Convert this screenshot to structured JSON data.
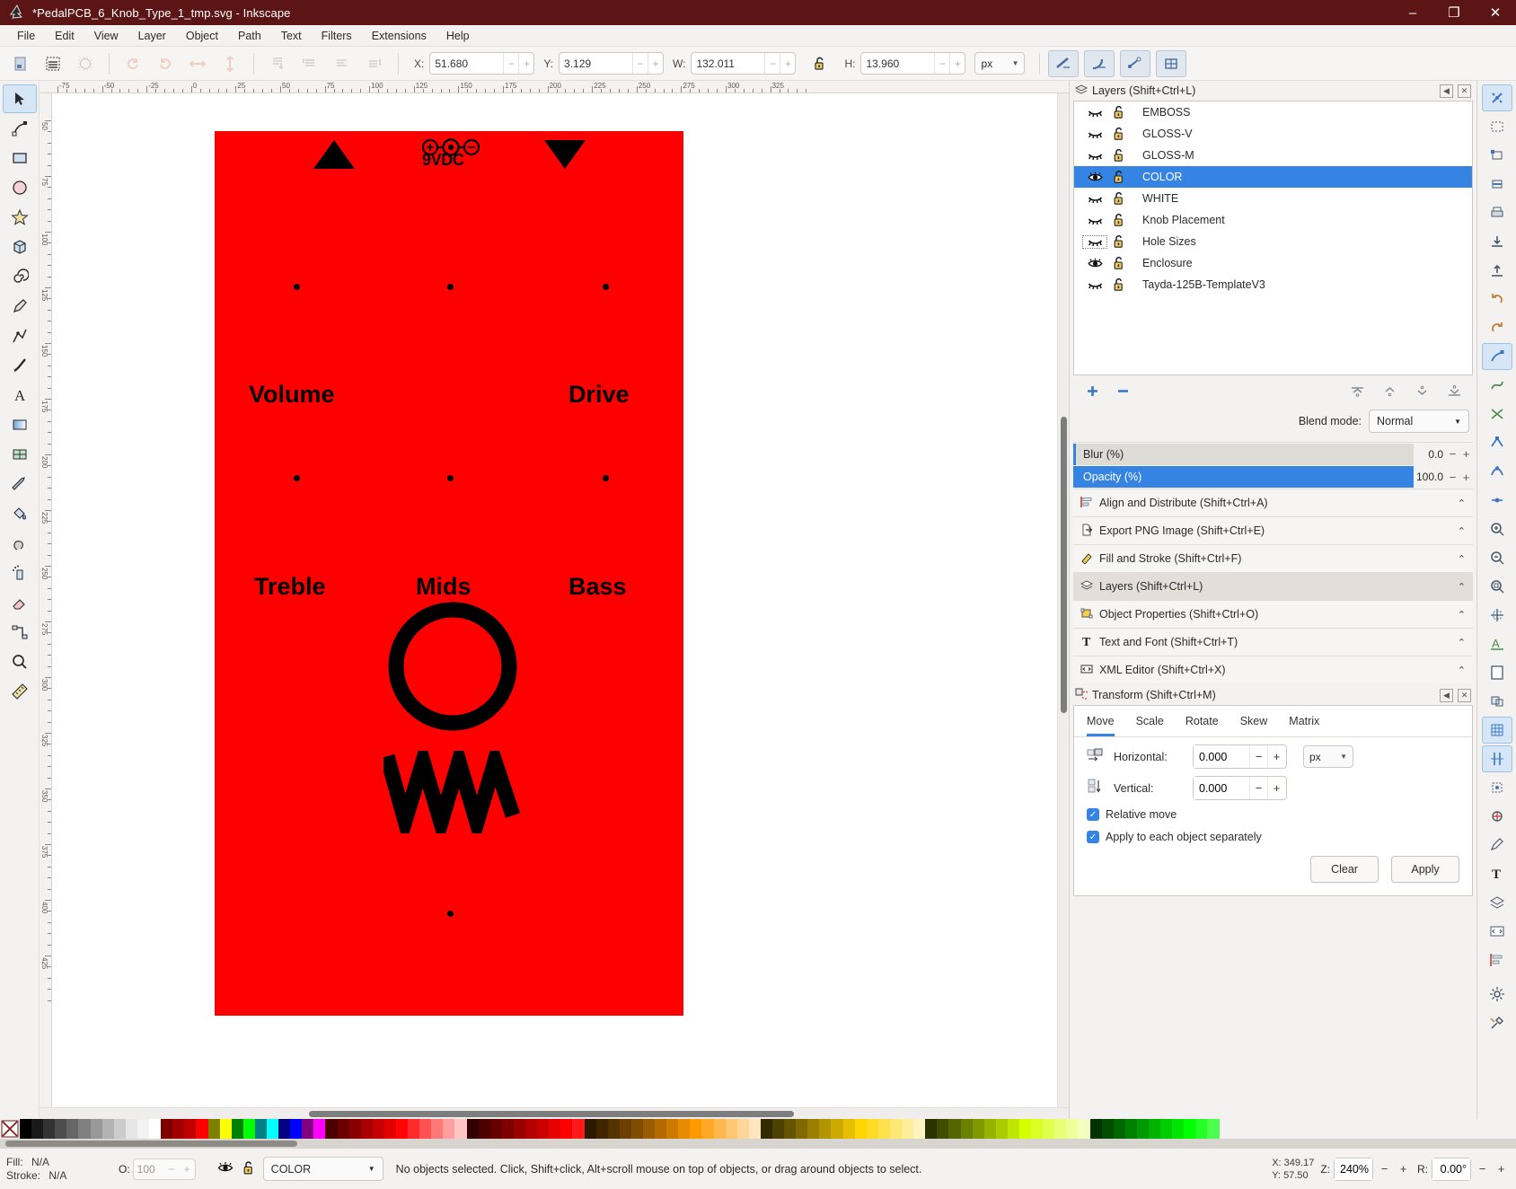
{
  "titlebar": {
    "title": "*PedalPCB_6_Knob_Type_1_tmp.svg - Inkscape",
    "minimize": "–",
    "maximize": "❐",
    "close": "✕"
  },
  "menubar": {
    "items": [
      {
        "label": "File"
      },
      {
        "label": "Edit"
      },
      {
        "label": "View"
      },
      {
        "label": "Layer"
      },
      {
        "label": "Object"
      },
      {
        "label": "Path"
      },
      {
        "label": "Text"
      },
      {
        "label": "Filters"
      },
      {
        "label": "Extensions"
      },
      {
        "label": "Help"
      }
    ]
  },
  "toolbar": {
    "x_label": "X:",
    "x_value": "51.680",
    "y_label": "Y:",
    "y_value": "3.129",
    "w_label": "W:",
    "w_value": "132.011",
    "h_label": "H:",
    "h_value": "13.960",
    "unit": "px",
    "minus": "−",
    "plus": "+"
  },
  "canvas": {
    "artwork": {
      "background_color": "#fe0000",
      "power_label": "9VDC",
      "knob_labels": [
        "Volume",
        "Drive",
        "Treble",
        "Mids",
        "Bass"
      ]
    },
    "hruler_labels": [
      "-75",
      "-50",
      "-25",
      "0",
      "25",
      "50",
      "75",
      "100",
      "125",
      "150",
      "175",
      "200",
      "225",
      "250",
      "275",
      "300",
      "325"
    ],
    "vruler_labels": [
      "50",
      "75",
      "100",
      "125",
      "150",
      "175",
      "200",
      "225",
      "250",
      "275",
      "300",
      "325",
      "350",
      "375",
      "400",
      "425"
    ]
  },
  "dock": {
    "layers_panel": {
      "title": "Layers (Shift+Ctrl+L)",
      "icon": "layers-icon",
      "layers": [
        {
          "name": "EMBOSS",
          "visible": false,
          "locked": false
        },
        {
          "name": "GLOSS-V",
          "visible": false,
          "locked": false
        },
        {
          "name": "GLOSS-M",
          "visible": false,
          "locked": false
        },
        {
          "name": "COLOR",
          "visible": true,
          "locked": false,
          "selected": true
        },
        {
          "name": "WHITE",
          "visible": false,
          "locked": false
        },
        {
          "name": "Knob Placement",
          "visible": false,
          "locked": false
        },
        {
          "name": "Hole Sizes",
          "visible": false,
          "locked": false,
          "focused": true
        },
        {
          "name": "Enclosure",
          "visible": true,
          "locked": false
        },
        {
          "name": "Tayda-125B-TemplateV3",
          "visible": false,
          "locked": false
        }
      ],
      "add_label": "+",
      "remove_label": "−",
      "blend_mode_label": "Blend mode:",
      "blend_mode_value": "Normal",
      "blur_label": "Blur (%)",
      "blur_value": "0.0",
      "opacity_label": "Opacity (%)",
      "opacity_value": "100.0",
      "minus": "−",
      "plus": "+"
    },
    "panels": [
      {
        "label": "Align and Distribute (Shift+Ctrl+A)",
        "icon": "align-icon",
        "active": false
      },
      {
        "label": "Export PNG Image (Shift+Ctrl+E)",
        "icon": "export-icon",
        "active": false
      },
      {
        "label": "Fill and Stroke (Shift+Ctrl+F)",
        "icon": "fill-icon",
        "active": false
      },
      {
        "label": "Layers (Shift+Ctrl+L)",
        "icon": "layers-icon",
        "active": true
      },
      {
        "label": "Object Properties (Shift+Ctrl+O)",
        "icon": "object-icon",
        "active": false
      },
      {
        "label": "Text and Font (Shift+Ctrl+T)",
        "icon": "text-icon",
        "active": false
      },
      {
        "label": "XML Editor (Shift+Ctrl+X)",
        "icon": "xml-icon",
        "active": false
      }
    ],
    "transform_panel": {
      "title": "Transform (Shift+Ctrl+M)",
      "icon": "transform-icon",
      "tabs": [
        {
          "label": "Move",
          "selected": true
        },
        {
          "label": "Scale",
          "selected": false
        },
        {
          "label": "Rotate",
          "selected": false
        },
        {
          "label": "Skew",
          "selected": false
        },
        {
          "label": "Matrix",
          "selected": false
        }
      ],
      "horizontal_label": "Horizontal:",
      "horizontal_value": "0.000",
      "vertical_label": "Vertical:",
      "vertical_value": "0.000",
      "unit": "px",
      "relative_move_label": "Relative move",
      "relative_move_checked": true,
      "apply_each_label": "Apply to each object separately",
      "apply_each_checked": true,
      "clear_label": "Clear",
      "apply_label": "Apply",
      "minus": "−",
      "plus": "+",
      "check": "✓"
    }
  },
  "statusbar": {
    "fill_label": "Fill:",
    "fill_value": "N/A",
    "stroke_label": "Stroke:",
    "stroke_value": "N/A",
    "opacity_label": "O:",
    "opacity_value": "100",
    "layer_name": "COLOR",
    "message": "No objects selected. Click, Shift+click, Alt+scroll mouse on top of objects, or drag around objects to select.",
    "x_label": "X:",
    "x_value": "349.17",
    "y_label": "Y:",
    "y_value": "57.50",
    "zoom_label": "Z:",
    "zoom_value": "240%",
    "rotate_label": "R:",
    "rotate_value": "0.00°",
    "minus": "−",
    "plus": "+"
  },
  "palette": {
    "colors": [
      "#000000",
      "#1a1a1a",
      "#333333",
      "#4d4d4d",
      "#666666",
      "#808080",
      "#999999",
      "#b3b3b3",
      "#cccccc",
      "#e6e6e6",
      "#f2f2f2",
      "#ffffff",
      "#800000",
      "#a00000",
      "#c00000",
      "#ff0000",
      "#808000",
      "#ffff00",
      "#008000",
      "#00ff00",
      "#008080",
      "#00ffff",
      "#000080",
      "#0000ff",
      "#800080",
      "#ff00ff",
      "#4d0000",
      "#6b0000",
      "#8a0000",
      "#a80000",
      "#c60000",
      "#e50000",
      "#ff0505",
      "#ff2b2b",
      "#ff5151",
      "#ff7878",
      "#ff9e9e",
      "#ffc4c4",
      "#330000",
      "#4d0000",
      "#660000",
      "#800000",
      "#990000",
      "#b30000",
      "#cc0000",
      "#e60000",
      "#ff0000",
      "#ff1a1a",
      "#2b1a00",
      "#402600",
      "#553300",
      "#6b4000",
      "#804d00",
      "#995c00",
      "#b36b00",
      "#cc7a00",
      "#e68a00",
      "#ff9900",
      "#ffa826",
      "#ffb84d",
      "#ffc773",
      "#ffd699",
      "#ffe6bf",
      "#332b00",
      "#4d4000",
      "#665500",
      "#806a00",
      "#998000",
      "#b39500",
      "#ccaa00",
      "#e6bf00",
      "#ffd500",
      "#ffdb26",
      "#ffe14d",
      "#ffe873",
      "#ffee99",
      "#fff4bf",
      "#2b3300",
      "#404d00",
      "#556600",
      "#6a8000",
      "#809900",
      "#95b300",
      "#aacc00",
      "#bfe600",
      "#d5ff00",
      "#dbff26",
      "#e1ff4d",
      "#e8ff73",
      "#eeff99",
      "#f4ffbf",
      "#003300",
      "#004d00",
      "#006600",
      "#008000",
      "#009900",
      "#00b300",
      "#00cc00",
      "#00e600",
      "#00ff00",
      "#26ff26",
      "#4dff4d"
    ]
  }
}
